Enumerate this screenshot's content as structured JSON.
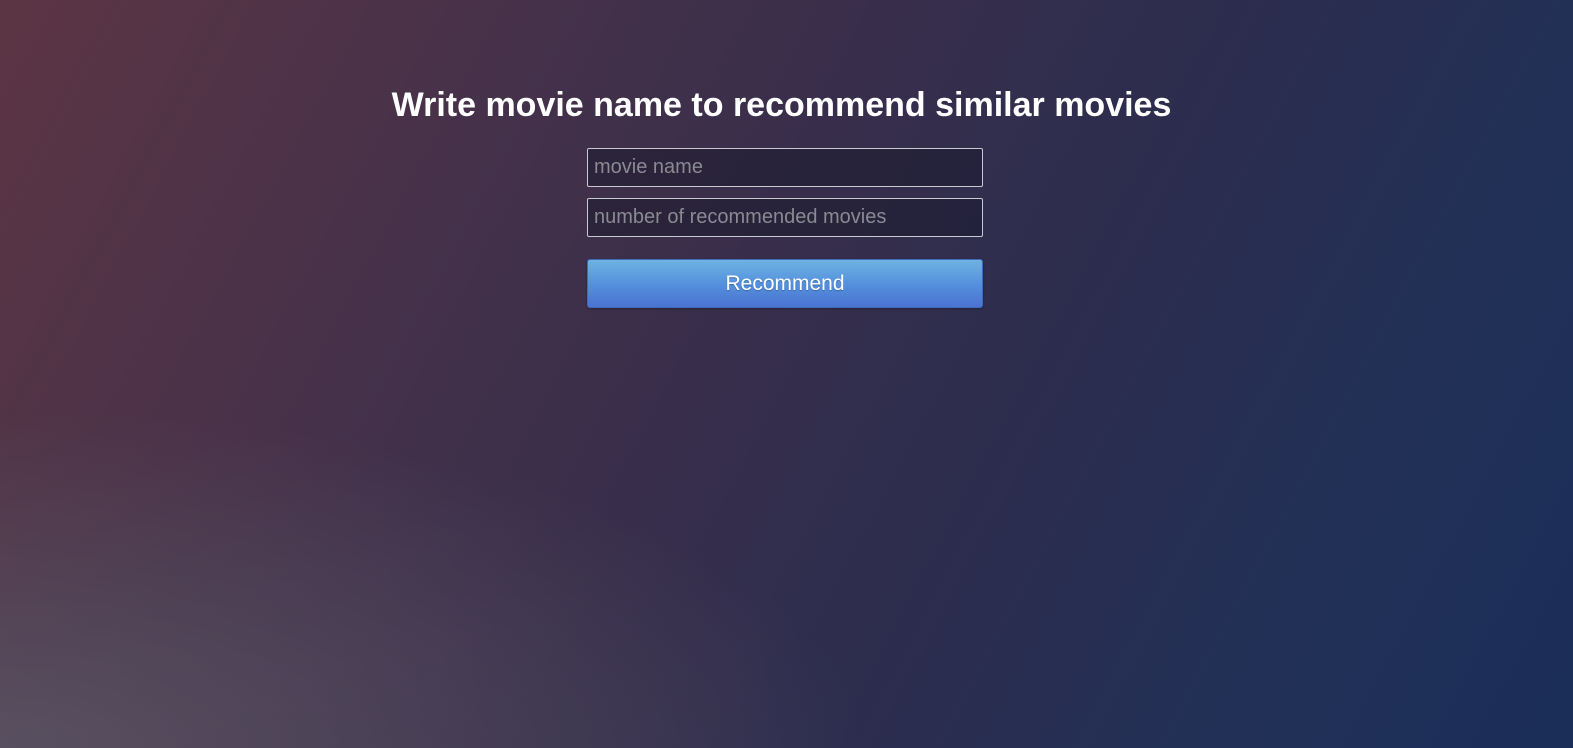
{
  "header": {
    "title": "Write movie name to recommend similar movies"
  },
  "form": {
    "movie_name": {
      "value": "",
      "placeholder": "movie name"
    },
    "count": {
      "value": "",
      "placeholder": "number of recommended movies"
    },
    "submit_label": "Recommend"
  },
  "colors": {
    "background_start": "#5c3544",
    "background_end": "#1a2e58",
    "button_top": "#6eb3e2",
    "button_bottom": "#4a73d2",
    "title_text": "#ffffff"
  }
}
